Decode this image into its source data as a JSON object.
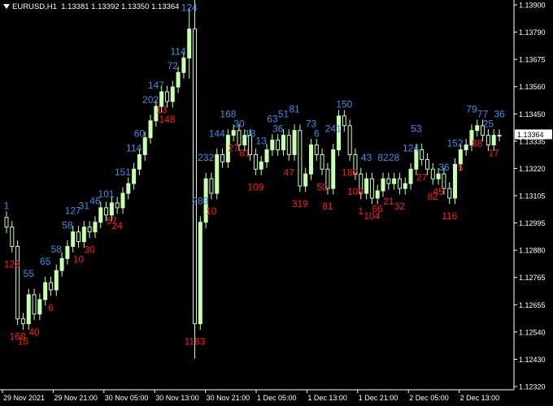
{
  "header": {
    "symbol": "EURUSD,H1",
    "ohlc": "1.13381 1.13392 1.13350 1.13364"
  },
  "current_price": "1.13364",
  "colors": {
    "background": "#000000",
    "axis": "#ffffff",
    "candle": "#c8ffb0",
    "label_high": "#3a8fe8",
    "label_low": "#ff1a1a",
    "price_tag_bg": "#ffffff"
  },
  "chart_data": {
    "type": "candlestick",
    "price_axis": [
      "1.13900",
      "1.13790",
      "1.13675",
      "1.13560",
      "1.13450",
      "1.13335",
      "1.13220",
      "1.13105",
      "1.12995",
      "1.12880",
      "1.12765",
      "1.12655",
      "1.12540",
      "1.12430",
      "1.12320"
    ],
    "time_axis": [
      "29 Nov 2021",
      "29 Nov 21:00",
      "30 Nov 05:00",
      "30 Nov 13:00",
      "30 Nov 21:00",
      "1 Dec 05:00",
      "1 Dec 13:00",
      "1 Dec 21:00",
      "2 Dec 05:00",
      "2 Dec 13:00"
    ],
    "ylim": [
      1.1232,
      1.1392
    ],
    "high_labels": [
      {
        "text": "1",
        "bar": 0
      },
      {
        "text": "55",
        "bar": 4
      },
      {
        "text": "65",
        "bar": 7
      },
      {
        "text": "58",
        "bar": 9
      },
      {
        "text": "58",
        "bar": 11
      },
      {
        "text": "127",
        "bar": 12
      },
      {
        "text": "31",
        "bar": 14
      },
      {
        "text": "46",
        "bar": 16
      },
      {
        "text": "101",
        "bar": 18
      },
      {
        "text": "151",
        "bar": 21
      },
      {
        "text": "114",
        "bar": 23
      },
      {
        "text": "60",
        "bar": 24
      },
      {
        "text": "147",
        "bar": 27
      },
      {
        "text": "202",
        "bar": 26
      },
      {
        "text": "72",
        "bar": 30
      },
      {
        "text": "114",
        "bar": 31
      },
      {
        "text": "124",
        "bar": 33
      },
      {
        "text": "283",
        "bar": 35
      },
      {
        "text": "232",
        "bar": 36
      },
      {
        "text": "144",
        "bar": 38
      },
      {
        "text": "168",
        "bar": 40
      },
      {
        "text": "30",
        "bar": 42
      },
      {
        "text": "18",
        "bar": 44
      },
      {
        "text": "13",
        "bar": 46
      },
      {
        "text": "63",
        "bar": 48
      },
      {
        "text": "36",
        "bar": 49
      },
      {
        "text": "51",
        "bar": 50
      },
      {
        "text": "81",
        "bar": 52
      },
      {
        "text": "73",
        "bar": 55
      },
      {
        "text": "6",
        "bar": 56
      },
      {
        "text": "241",
        "bar": 59
      },
      {
        "text": "150",
        "bar": 61
      },
      {
        "text": "43",
        "bar": 65
      },
      {
        "text": "82",
        "bar": 68
      },
      {
        "text": "28",
        "bar": 70
      },
      {
        "text": "53",
        "bar": 74
      },
      {
        "text": "124",
        "bar": 73
      },
      {
        "text": "36",
        "bar": 79
      },
      {
        "text": "152",
        "bar": 81
      },
      {
        "text": "79",
        "bar": 84
      },
      {
        "text": "77",
        "bar": 86
      },
      {
        "text": "25",
        "bar": 87
      },
      {
        "text": "36",
        "bar": 89
      }
    ],
    "low_labels": [
      {
        "text": "123",
        "bar": 1
      },
      {
        "text": "168",
        "bar": 2
      },
      {
        "text": "15",
        "bar": 3
      },
      {
        "text": "40",
        "bar": 5
      },
      {
        "text": "6",
        "bar": 8
      },
      {
        "text": "10",
        "bar": 13
      },
      {
        "text": "30",
        "bar": 15
      },
      {
        "text": "57",
        "bar": 19
      },
      {
        "text": "24",
        "bar": 20
      },
      {
        "text": "13",
        "bar": 28
      },
      {
        "text": "148",
        "bar": 29
      },
      {
        "text": "1183",
        "bar": 34
      },
      {
        "text": "10",
        "bar": 37
      },
      {
        "text": "27",
        "bar": 41
      },
      {
        "text": "81",
        "bar": 43
      },
      {
        "text": "109",
        "bar": 45
      },
      {
        "text": "47",
        "bar": 51
      },
      {
        "text": "319",
        "bar": 53
      },
      {
        "text": "50",
        "bar": 57
      },
      {
        "text": "81",
        "bar": 58
      },
      {
        "text": "182",
        "bar": 62
      },
      {
        "text": "109",
        "bar": 63
      },
      {
        "text": "1",
        "bar": 64
      },
      {
        "text": "104",
        "bar": 66
      },
      {
        "text": "66",
        "bar": 67
      },
      {
        "text": "21",
        "bar": 69
      },
      {
        "text": "32",
        "bar": 71
      },
      {
        "text": "27",
        "bar": 75
      },
      {
        "text": "82",
        "bar": 77
      },
      {
        "text": "45",
        "bar": 78
      },
      {
        "text": "116",
        "bar": 80
      },
      {
        "text": "5",
        "bar": 82
      },
      {
        "text": "88",
        "bar": 85
      },
      {
        "text": "17",
        "bar": 88
      }
    ]
  }
}
